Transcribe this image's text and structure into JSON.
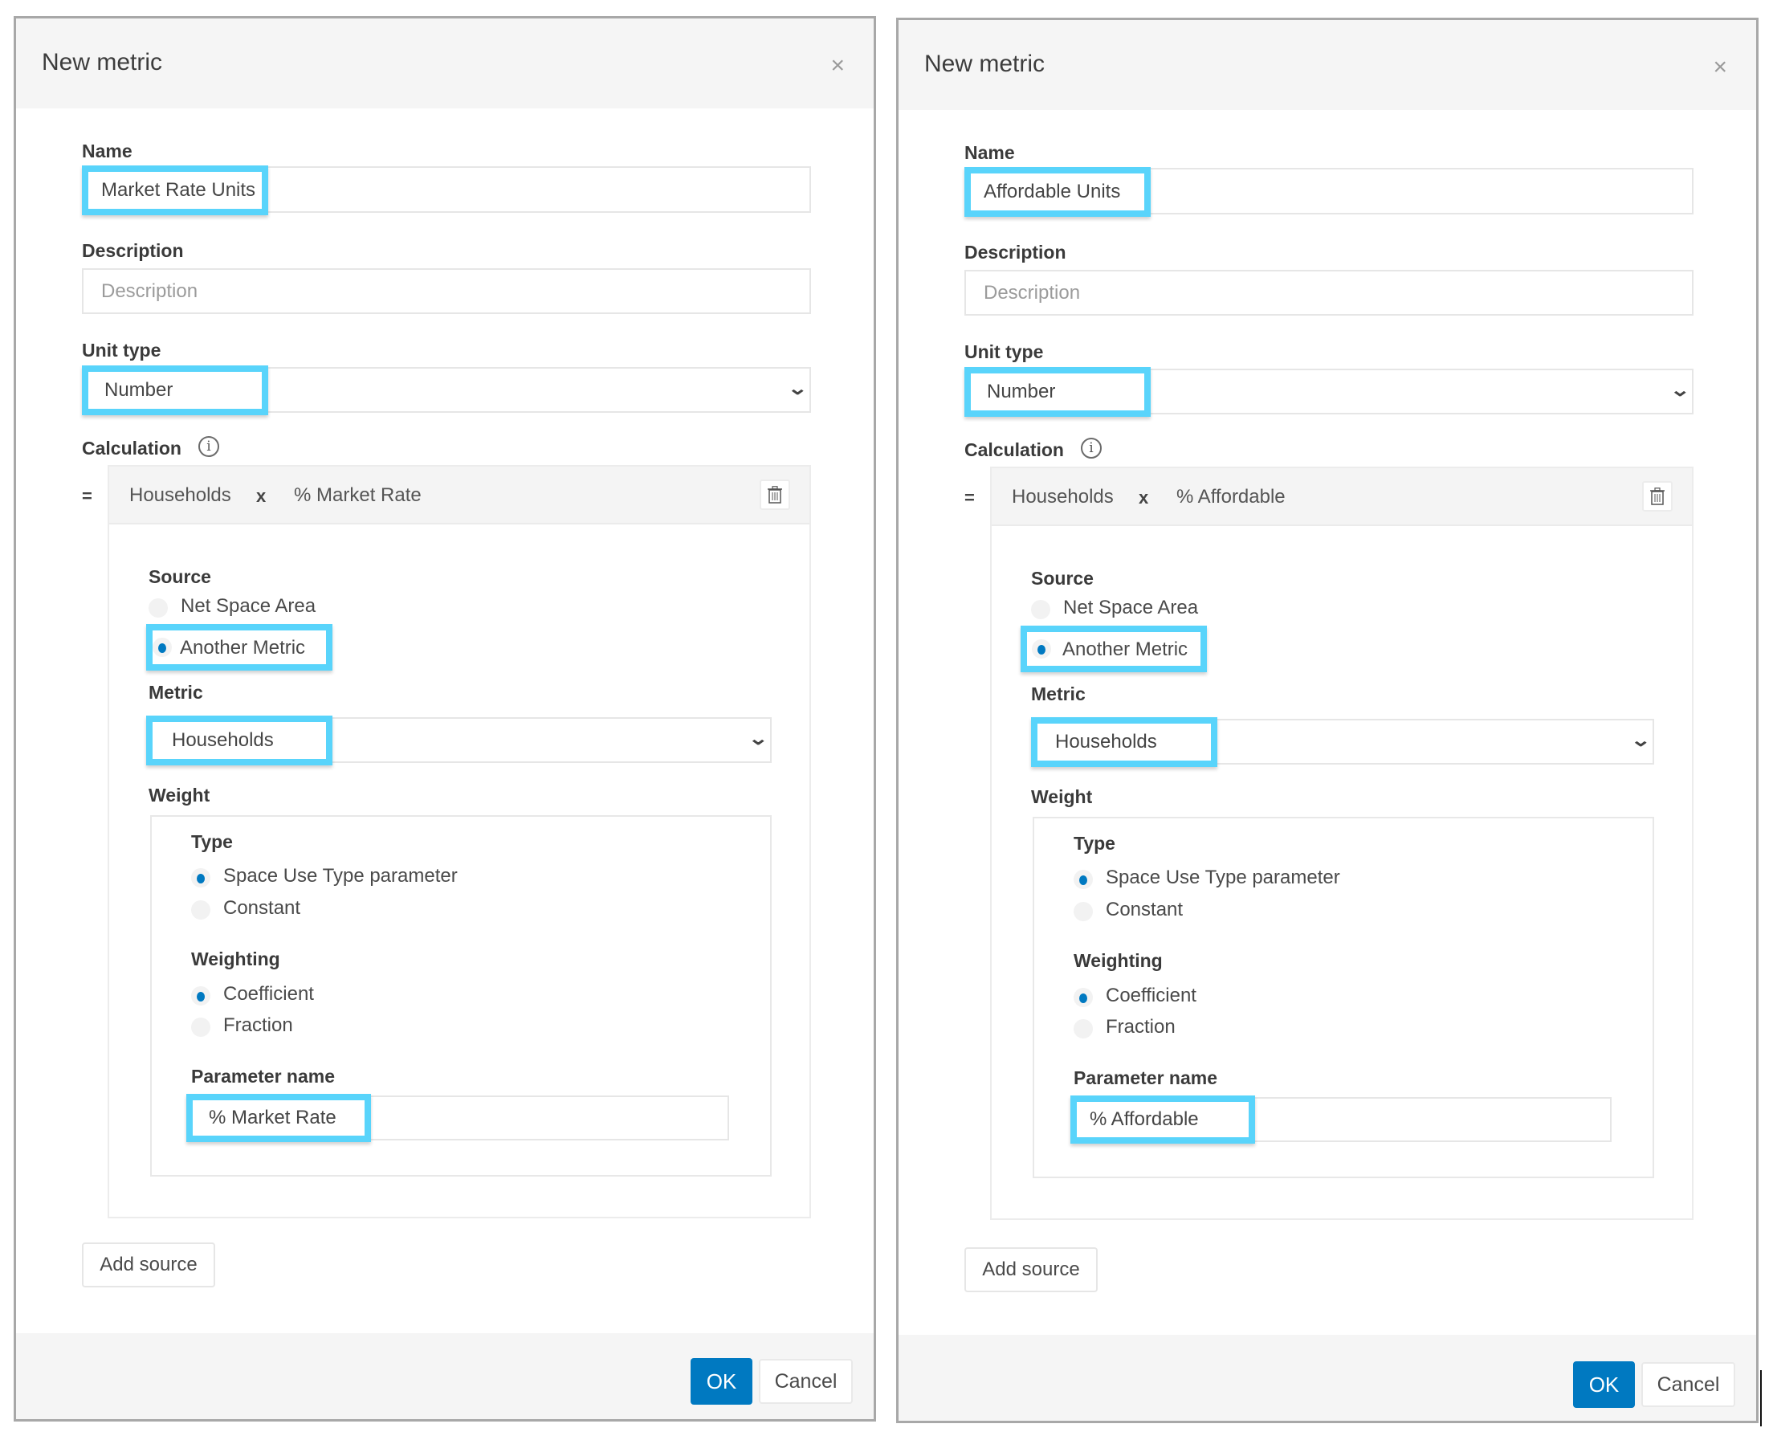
{
  "dialogs": [
    {
      "title": "New metric",
      "close_icon": "close-icon",
      "name": {
        "label": "Name",
        "value": "Market Rate Units"
      },
      "description": {
        "label": "Description",
        "placeholder": "Description",
        "value": ""
      },
      "unit_type": {
        "label": "Unit type",
        "value": "Number",
        "icon": "chevron-down-icon"
      },
      "calculation": {
        "label": "Calculation",
        "info_icon": "info-icon",
        "equals": "=",
        "expression": {
          "left": "Households",
          "operator": "x",
          "right": "% Market Rate"
        },
        "delete_icon": "trash-icon",
        "source": {
          "label": "Source",
          "options": [
            {
              "label": "Net Space Area",
              "selected": false
            },
            {
              "label": "Another Metric",
              "selected": true
            }
          ]
        },
        "metric": {
          "label": "Metric",
          "value": "Households",
          "icon": "chevron-down-icon"
        },
        "weight": {
          "label": "Weight",
          "type": {
            "label": "Type",
            "options": [
              {
                "label": "Space Use Type parameter",
                "selected": true
              },
              {
                "label": "Constant",
                "selected": false
              }
            ]
          },
          "weighting": {
            "label": "Weighting",
            "options": [
              {
                "label": "Coefficient",
                "selected": true
              },
              {
                "label": "Fraction",
                "selected": false
              }
            ]
          },
          "parameter_name": {
            "label": "Parameter name",
            "value": "% Market Rate"
          }
        }
      },
      "add_source_label": "Add source",
      "footer": {
        "ok_label": "OK",
        "cancel_label": "Cancel"
      }
    },
    {
      "title": "New metric",
      "close_icon": "close-icon",
      "name": {
        "label": "Name",
        "value": "Affordable Units"
      },
      "description": {
        "label": "Description",
        "placeholder": "Description",
        "value": ""
      },
      "unit_type": {
        "label": "Unit type",
        "value": "Number",
        "icon": "chevron-down-icon"
      },
      "calculation": {
        "label": "Calculation",
        "info_icon": "info-icon",
        "equals": "=",
        "expression": {
          "left": "Households",
          "operator": "x",
          "right": "% Affordable"
        },
        "delete_icon": "trash-icon",
        "source": {
          "label": "Source",
          "options": [
            {
              "label": "Net Space Area",
              "selected": false
            },
            {
              "label": "Another Metric",
              "selected": true
            }
          ]
        },
        "metric": {
          "label": "Metric",
          "value": "Households",
          "icon": "chevron-down-icon"
        },
        "weight": {
          "label": "Weight",
          "type": {
            "label": "Type",
            "options": [
              {
                "label": "Space Use Type parameter",
                "selected": true
              },
              {
                "label": "Constant",
                "selected": false
              }
            ]
          },
          "weighting": {
            "label": "Weighting",
            "options": [
              {
                "label": "Coefficient",
                "selected": true
              },
              {
                "label": "Fraction",
                "selected": false
              }
            ]
          },
          "parameter_name": {
            "label": "Parameter name",
            "value": "% Affordable"
          }
        }
      },
      "add_source_label": "Add source",
      "footer": {
        "ok_label": "OK",
        "cancel_label": "Cancel"
      }
    }
  ],
  "colors": {
    "highlight": "#59d4fb",
    "accent": "#0079c1",
    "header_bg": "#f5f5f5"
  }
}
